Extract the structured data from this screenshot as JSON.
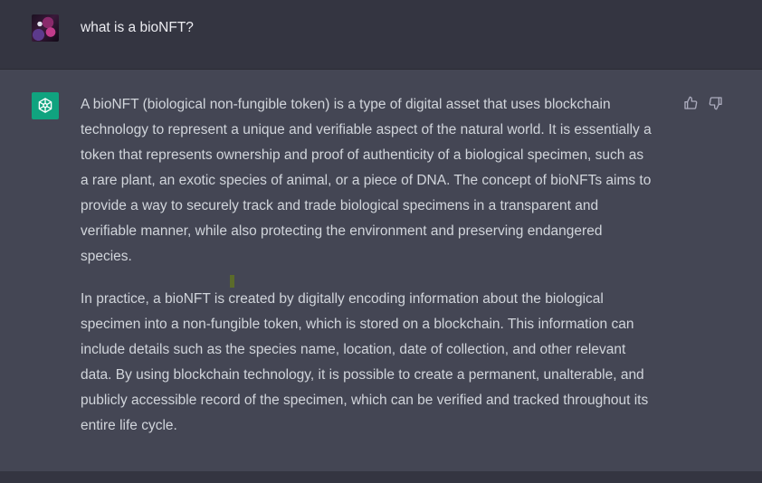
{
  "user_message": {
    "text": "what is a bioNFT?"
  },
  "assistant_message": {
    "paragraphs": [
      "A bioNFT (biological non-fungible token) is a type of digital asset that uses blockchain\ntechnology to represent a unique and verifiable aspect of the natural world. It is essentially a\ntoken that represents ownership and proof of authenticity of a biological specimen, such as\na rare plant, an exotic species of animal, or a piece of DNA. The concept of bioNFTs aims to\nprovide a way to securely track and trade biological specimens in a transparent and\nverifiable manner, while also protecting the environment and preserving endangered\nspecies.",
      "In practice, a bioNFT is created by digitally encoding information about the biological\nspecimen into a non-fungible token, which is stored on a blockchain. This information can\ninclude details such as the species name, location, date of collection, and other relevant\ndata. By using blockchain technology, it is possible to create a permanent, unalterable, and\npublicly accessible record of the specimen, which can be verified and tracked throughout its\nentire life cycle."
    ]
  },
  "icons": {
    "user_avatar": "user-avatar",
    "bot_avatar": "openai-logo-icon",
    "thumbs_up": "thumbs-up-icon",
    "thumbs_down": "thumbs-down-icon"
  },
  "colors": {
    "user_bg": "#343541",
    "assistant_bg": "#444654",
    "bot_avatar_bg": "#10a37f",
    "text": "#d1d5db"
  }
}
